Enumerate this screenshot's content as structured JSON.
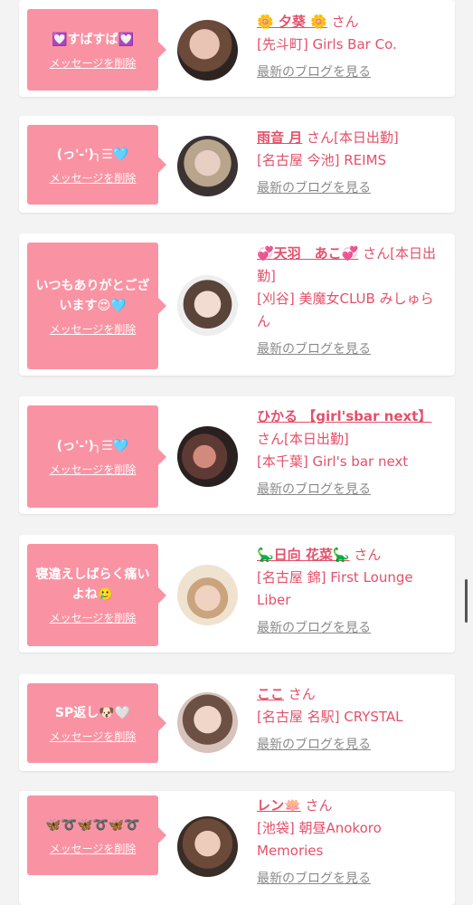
{
  "delete_label": "メッセージを削除",
  "blog_label": "最新のブログを見る",
  "san": "さん",
  "colors": {
    "accent": "#e4506a",
    "bubble": "#f993a3",
    "link_gray": "#8a8a8a"
  },
  "cards": [
    {
      "message": "💟すばすば💟",
      "name": "🌼 夕葵 🌼",
      "status": "",
      "shop": "[先斗町] Girls Bar Co."
    },
    {
      "message": "(っ'-')╮☰🩵",
      "name": "雨音 月",
      "status": "[本日出勤]",
      "shop": "[名古屋 今池] REIMS"
    },
    {
      "message": "いつもありがとございます😍🩵",
      "name": "💞天羽　あこ💞",
      "status": "[本日出勤]",
      "shop": "[刈谷] 美魔女CLUB みしゅらん"
    },
    {
      "message": "(っ'-')╮☰🩵",
      "name": "ひかる 【girl'sbar next】",
      "status": "[本日出勤]",
      "shop": "[本千葉] Girl's bar next"
    },
    {
      "message": "寝違えしばらく痛いよね🥲",
      "name": "🦕日向 花菜🦕",
      "status": "",
      "shop": "[名古屋 錦] First Lounge Liber"
    },
    {
      "message": "SP返し🐶🤍",
      "name": "ここ",
      "status": "",
      "shop": "[名古屋 名駅] CRYSTAL"
    },
    {
      "message": "🦋➰🦋➰🦋➰",
      "name": "レン🪷",
      "status": "",
      "shop": "[池袋] 朝昼Anokoro Memories"
    }
  ]
}
